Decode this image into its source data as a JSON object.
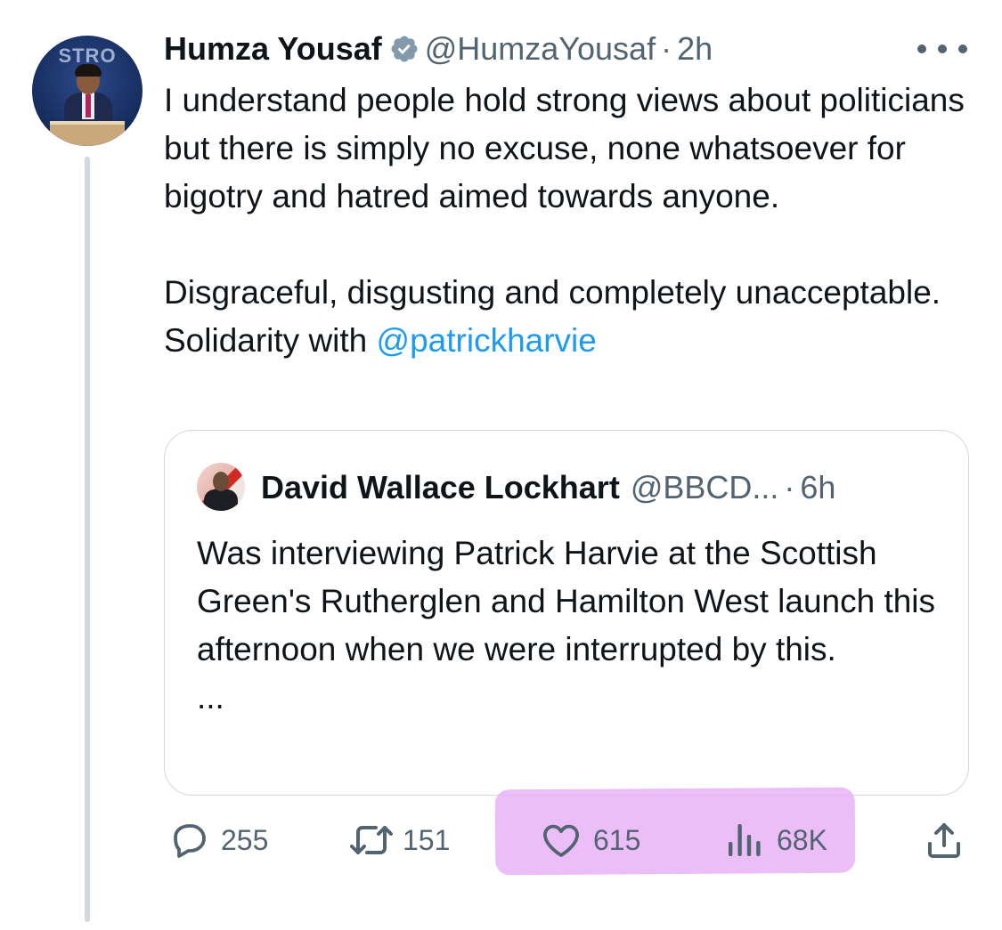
{
  "tweet": {
    "author_name": "Humza Yousaf",
    "handle": "@HumzaYousaf",
    "dot": "·",
    "time": "2h",
    "avatar_sign": "STRO",
    "text_paragraph_1": "I understand people hold strong views about politicians but there is simply no excuse, none whatsoever for bigotry and hatred aimed towards anyone.",
    "text_paragraph_2": "Disgraceful, disgusting and completely unacceptable. Solidarity with ",
    "mention": "@patrickharvie"
  },
  "quoted_tweet": {
    "author_name": "David Wallace Lockhart",
    "handle": "@BBCD...",
    "dot": "·",
    "time": "6h",
    "text": "Was interviewing Patrick Harvie at the Scottish Green's Rutherglen and Hamilton West launch this afternoon when we were interrupted by this.",
    "ellipsis": "..."
  },
  "actions": {
    "replies": "255",
    "reposts": "151",
    "likes": "615",
    "views": "68K"
  },
  "colors": {
    "text": "#0f1419",
    "muted": "#536471",
    "link": "#1d9bf0",
    "verified": "#829aab",
    "highlight": "#e7b3f7",
    "border": "#cfd9de"
  },
  "icons": {
    "more": "more-horizontal-icon",
    "verified": "verified-badge-icon",
    "reply": "reply-bubble-icon",
    "repost": "repost-arrows-icon",
    "like": "heart-icon",
    "views": "bar-chart-icon",
    "share": "share-upload-icon"
  }
}
